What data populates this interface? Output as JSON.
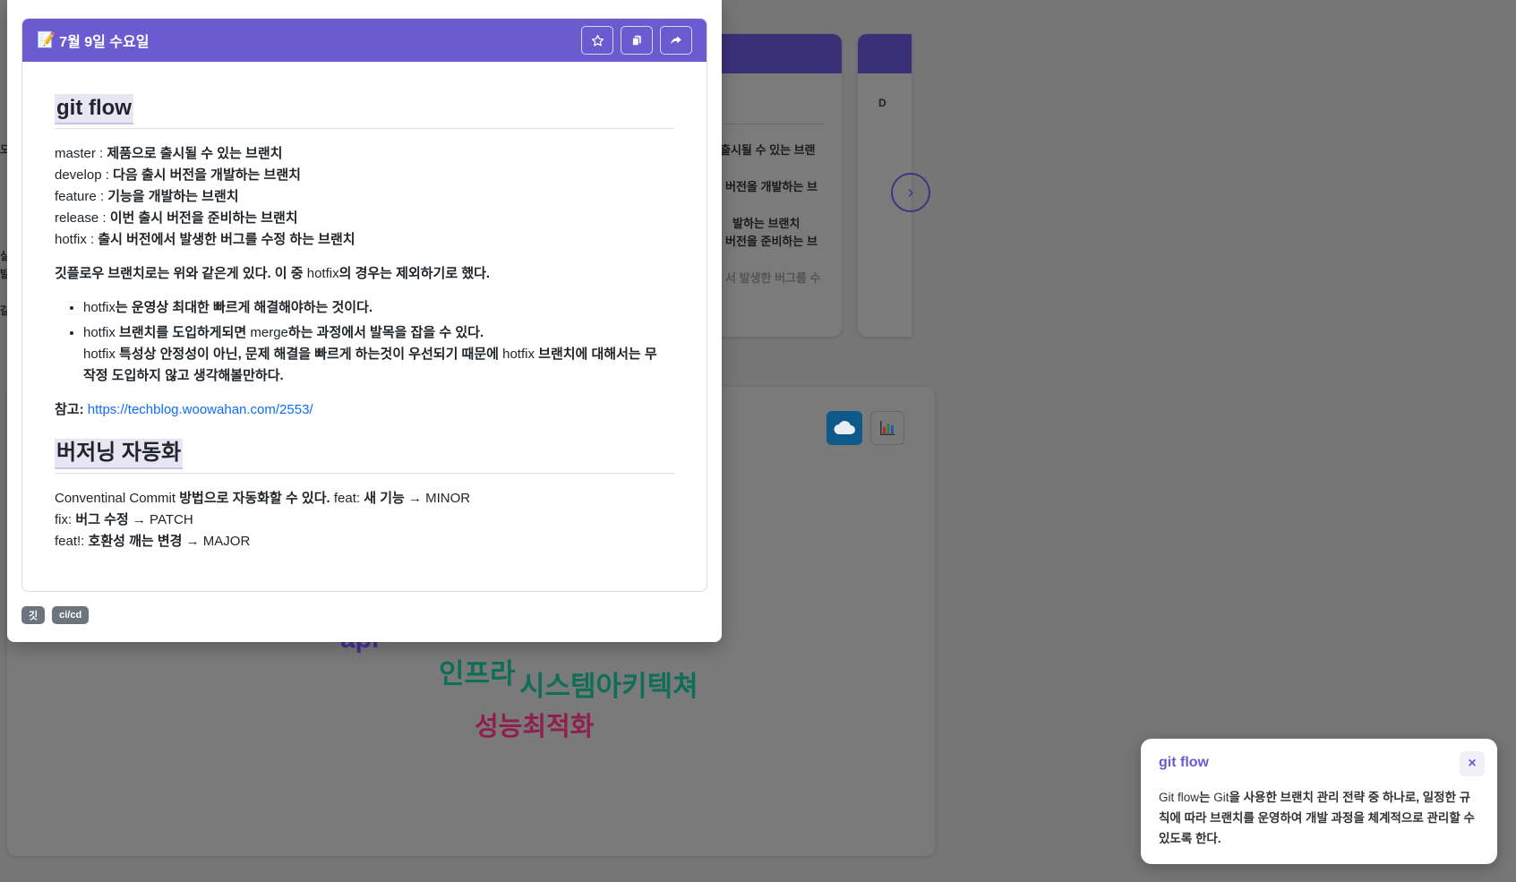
{
  "note": {
    "icon": "memo-icon",
    "title": "7월 9일 수요일",
    "actions": [
      {
        "name": "star-icon",
        "glyph": "☆"
      },
      {
        "name": "copy-icon",
        "glyph": "❐"
      },
      {
        "name": "share-icon",
        "glyph": "➦"
      }
    ],
    "sections": {
      "git_flow_heading": "git flow",
      "branches": [
        {
          "key": "master : ",
          "desc": "제품으로 출시될 수 있는 브랜치"
        },
        {
          "key": "develop : ",
          "desc": "다음 출시 버전을 개발하는 브랜치"
        },
        {
          "key": "feature : ",
          "desc": "기능을 개발하는 브랜치"
        },
        {
          "key": "release : ",
          "desc": "이번 출시 버전을 준비하는 브랜치"
        },
        {
          "key": "hotfix : ",
          "desc": "출시 버전에서 발생한 버그를 수정 하는 브랜치"
        }
      ],
      "summary": {
        "a": "깃플로우 브랜치로는 위와 같은게 있다. 이 중 ",
        "b": "hotfix",
        "c": "의 경우는 제외하기로 했다."
      },
      "bullet1": {
        "a": "hotfix",
        "b": "는 운영상 최대한 빠르게 해결해야하는 것이다."
      },
      "bullet2": {
        "a": "hotfix ",
        "b": "브랜치를 도입하게되면 ",
        "c": "merge",
        "d": "하는 과정에서 발목을 잡을 수 있다.",
        "e": "hotfix ",
        "f": "특성상 안정성이 아닌, 문제 해결을 빠르게 하는것이 우선되기 때문에 ",
        "g": "hotfix ",
        "h": "브랜치에 대해서는 무",
        "i": "작정 도입하지 않고 생각해볼만하다."
      },
      "reference": {
        "label": "참고: ",
        "url": "https://techblog.woowahan.com/2553/"
      },
      "versioning_heading": "버저닝 자동화",
      "versioning": {
        "l1a": "Conventinal Commit ",
        "l1b": "방법으로 자동화할 수 있다.",
        "l1c": " feat: ",
        "l1d": "새 기능",
        "l1e": " → MINOR",
        "l2a": "fix: ",
        "l2b": "버그 수정",
        "l2c": " → PATCH",
        "l3a": "feat!: ",
        "l3b": "호환성 깨는 변경",
        "l3c": " → MAJOR"
      }
    },
    "tags": [
      "깃",
      "ci/cd"
    ]
  },
  "background": {
    "snippets": [
      "출시될 수 있는 브랜",
      "버전을 개발하는 브",
      "발하는 브랜치",
      "버전을 준비하는 브",
      "서 발생한 버그를 수"
    ],
    "edge_letters": [
      "도",
      "실",
      "발",
      "갈",
      "D"
    ],
    "next_glyph": "›",
    "cloud_words": [
      {
        "text": "api",
        "color": "#4a2f9a"
      },
      {
        "text": "인프라",
        "color": "#0f6e57"
      },
      {
        "text": "시스템아키텍쳐",
        "color": "#0f6e57"
      },
      {
        "text": "성능최적화",
        "color": "#8f1f4f"
      }
    ]
  },
  "toast": {
    "title": "git flow",
    "close": "×",
    "body": {
      "a": "Git flow",
      "b": "는 ",
      "c": "Git",
      "d": "을 사용한 브랜치 관리 전략 중 하나로, 일정한 규칙에 따라 브랜치를 운영하여 개발 과정을 체계적으로 관리할 수 있도록 한다."
    }
  }
}
